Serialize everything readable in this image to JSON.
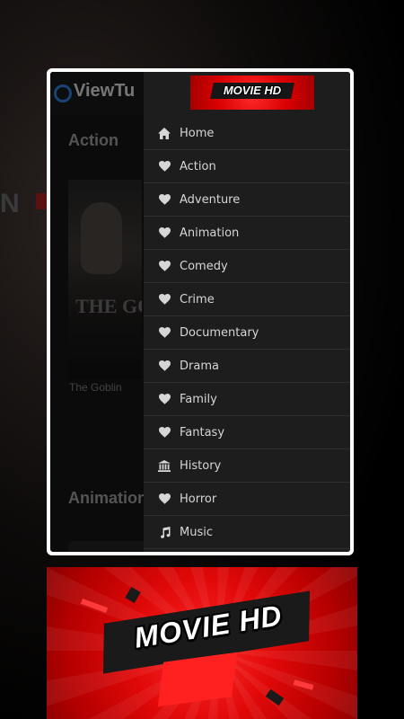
{
  "app": {
    "logo_text": "ViewTu",
    "sections": [
      {
        "title": "Action"
      },
      {
        "title": "Animation"
      }
    ],
    "poster_title": "THE GO",
    "poster_caption": "The Goblin",
    "background_text": "N"
  },
  "drawer": {
    "logo_text": "MOVIE HD",
    "items": [
      {
        "label": "Home",
        "icon": "home-icon"
      },
      {
        "label": "Action",
        "icon": "heart-icon"
      },
      {
        "label": "Adventure",
        "icon": "heart-icon"
      },
      {
        "label": "Animation",
        "icon": "heart-icon"
      },
      {
        "label": "Comedy",
        "icon": "heart-icon"
      },
      {
        "label": "Crime",
        "icon": "heart-icon"
      },
      {
        "label": "Documentary",
        "icon": "heart-icon"
      },
      {
        "label": "Drama",
        "icon": "heart-icon"
      },
      {
        "label": "Family",
        "icon": "heart-icon"
      },
      {
        "label": "Fantasy",
        "icon": "heart-icon"
      },
      {
        "label": "History",
        "icon": "museum-icon"
      },
      {
        "label": "Horror",
        "icon": "heart-icon"
      },
      {
        "label": "Music",
        "icon": "music-note-icon"
      }
    ]
  },
  "banner": {
    "text": "MOVIE HD"
  },
  "colors": {
    "accent_red": "#e10909",
    "drawer_bg": "#1d1d1d",
    "frame": "#ffffff",
    "logo_blue": "#2f7bd6"
  }
}
